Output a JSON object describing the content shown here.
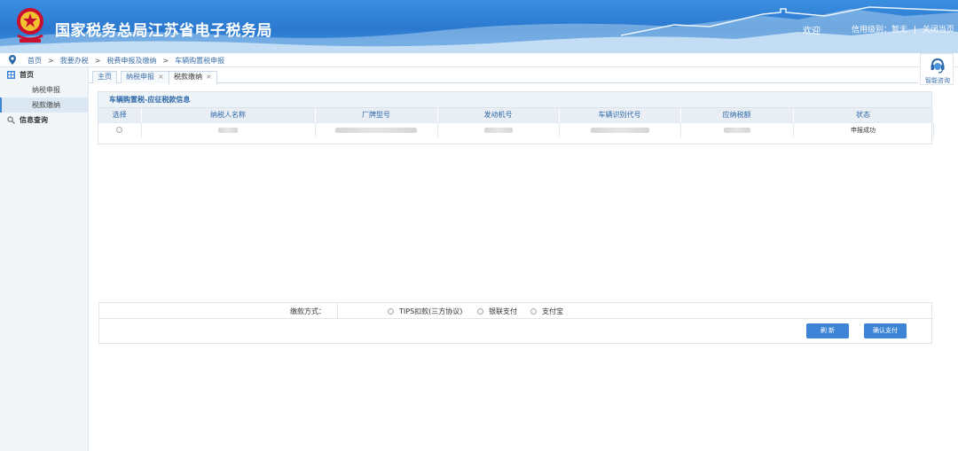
{
  "header": {
    "site_title": "国家税务总局江苏省电子税务局",
    "welcome": "欢迎",
    "credit_level": "信用级别：暂无",
    "separator": "|",
    "close_page": "关闭当页"
  },
  "breadcrumb": {
    "items": [
      "首页",
      "我要办税",
      "税费申报及缴纳",
      "车辆购置税申报"
    ],
    "arrow": ">"
  },
  "sidebar": {
    "items": [
      {
        "label": "首页",
        "icon": "grid-icon"
      },
      {
        "label": "纳税申报"
      },
      {
        "label": "税款缴纳"
      },
      {
        "label": "信息查询",
        "icon": "search-icon"
      }
    ]
  },
  "tabs": [
    {
      "label": "主页",
      "closable": false
    },
    {
      "label": "纳税申报",
      "closable": true
    },
    {
      "label": "税款缴纳",
      "closable": true
    }
  ],
  "tab_close": "×",
  "help": {
    "label": "智能咨询",
    "icon": "headset-icon"
  },
  "panel": {
    "title": "车辆购置税-应征税款信息",
    "columns": [
      "选择",
      "纳税人名称",
      "厂牌型号",
      "发动机号",
      "车辆识别代号",
      "应纳税额",
      "状态"
    ],
    "rows": [
      {
        "status": "申报成功"
      }
    ]
  },
  "payment": {
    "label": "缴款方式：",
    "options": [
      "TIPS扣款(三方协议)",
      "银联支付",
      "支付宝"
    ]
  },
  "buttons": {
    "refresh": "刷 新",
    "confirm": "确认支付"
  },
  "colors": {
    "header_blue": "#2b79cf",
    "accent": "#3e84d6",
    "link": "#3a6ea8"
  }
}
